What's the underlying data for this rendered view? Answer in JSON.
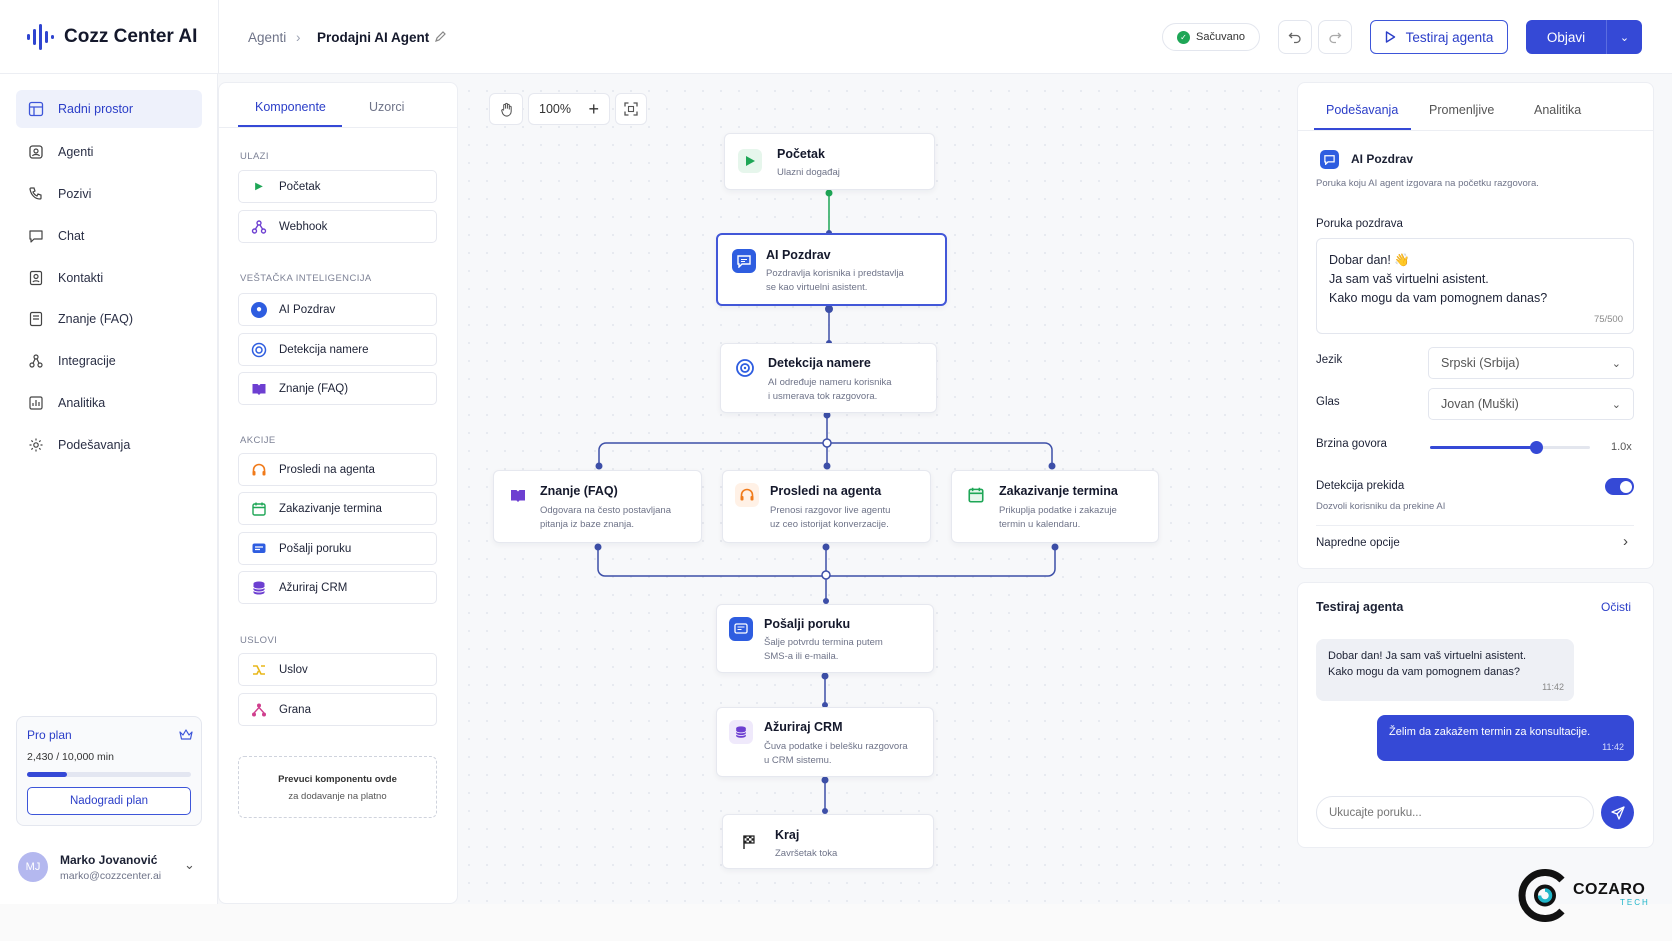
{
  "app": {
    "name": "Cozz Center AI"
  },
  "breadcrumb": {
    "parent": "Agenti",
    "current": "Prodajni AI Agent"
  },
  "header": {
    "saved_label": "Sačuvano",
    "test_button": "Testiraj agenta",
    "publish_button": "Objavi"
  },
  "sidebar": {
    "items": [
      {
        "label": "Radni prostor",
        "icon": "grid-icon"
      },
      {
        "label": "Agenti",
        "icon": "bot-icon"
      },
      {
        "label": "Pozivi",
        "icon": "phone-icon"
      },
      {
        "label": "Chat",
        "icon": "chat-icon"
      },
      {
        "label": "Kontakti",
        "icon": "contacts-icon"
      },
      {
        "label": "Znanje (FAQ)",
        "icon": "book-icon"
      },
      {
        "label": "Integracije",
        "icon": "integrations-icon"
      },
      {
        "label": "Analitika",
        "icon": "chart-icon"
      },
      {
        "label": "Podešavanja",
        "icon": "gear-icon"
      }
    ],
    "plan": {
      "name": "Pro plan",
      "usage": "2,430 / 10,000 min",
      "usage_fraction": 0.243,
      "upgrade_button": "Nadogradi plan"
    },
    "user": {
      "initials": "MJ",
      "name": "Marko Jovanović",
      "email": "marko@cozzcenter.ai"
    }
  },
  "components": {
    "tabs": [
      "Komponente",
      "Uzorci"
    ],
    "sections": [
      {
        "title": "ULAZI",
        "items": [
          "Početak",
          "Webhook"
        ]
      },
      {
        "title": "VEŠTAČKA INTELIGENCIJA",
        "items": [
          "AI Pozdrav",
          "Detekcija namere",
          "Znanje (FAQ)"
        ]
      },
      {
        "title": "AKCIJE",
        "items": [
          "Prosledi na agenta",
          "Zakazivanje termina",
          "Pošalji poruku",
          "Ažuriraj CRM"
        ]
      },
      {
        "title": "USLOVI",
        "items": [
          "Uslov",
          "Grana"
        ]
      }
    ],
    "drop_hint_line1": "Prevuci komponentu ovde",
    "drop_hint_line2": "za dodavanje na platno"
  },
  "canvas": {
    "zoom": "100%",
    "nodes": {
      "start": {
        "title": "Početak",
        "desc": "Ulazni događaj"
      },
      "greeting": {
        "title": "AI Pozdrav",
        "desc1": "Pozdravlja korisnika i predstavlja",
        "desc2": "se kao virtuelni asistent."
      },
      "intent": {
        "title": "Detekcija namere",
        "desc1": "AI određuje nameru korisnika",
        "desc2": "i usmerava tok razgovora."
      },
      "faq": {
        "title": "Znanje (FAQ)",
        "desc1": "Odgovara na često postavljana",
        "desc2": "pitanja iz baze znanja."
      },
      "handoff": {
        "title": "Prosledi na agenta",
        "desc1": "Prenosi razgovor live agentu",
        "desc2": "uz ceo istorijat konverzacije."
      },
      "schedule": {
        "title": "Zakazivanje termina",
        "desc1": "Prikuplja podatke i zakazuje",
        "desc2": "termin u kalendaru."
      },
      "message": {
        "title": "Pošalji poruku",
        "desc1": "Šalje potvrdu termina putem",
        "desc2": "SMS-a ili e-maila."
      },
      "crm": {
        "title": "Ažuriraj CRM",
        "desc1": "Čuva podatke i belešku razgovora",
        "desc2": "u CRM sistemu."
      },
      "end": {
        "title": "Kraj",
        "desc": "Završetak toka"
      }
    }
  },
  "settings": {
    "tabs": [
      "Podešavanja",
      "Promenljive",
      "Analitika"
    ],
    "node_title": "AI Pozdrav",
    "node_desc": "Poruka koju AI agent izgovara na početku razgovora.",
    "greeting_label": "Poruka pozdrava",
    "greeting_line1": "Dobar dan! 👋",
    "greeting_line2": "Ja sam vaš virtuelni asistent.",
    "greeting_line3": "Kako mogu da vam pomognem danas?",
    "char_count": "75/500",
    "language_label": "Jezik",
    "language_value": "Srpski (Srbija)",
    "voice_label": "Glas",
    "voice_value": "Jovan (Muški)",
    "speed_label": "Brzina govora",
    "speed_value": "1.0x",
    "speed_fraction": 0.66,
    "interrupt_label": "Detekcija prekida",
    "interrupt_desc": "Dozvoli korisniku da prekine AI",
    "interrupt_on": true,
    "advanced_label": "Napredne opcije"
  },
  "tester": {
    "title": "Testiraj agenta",
    "clear": "Očisti",
    "bot_line1": "Dobar dan! Ja sam vaš virtuelni asistent.",
    "bot_line2": "Kako mogu da vam pomognem danas?",
    "bot_time": "11:42",
    "user_msg": "Želim da zakažem termin za konsultacije.",
    "user_time": "11:42",
    "input_placeholder": "Ukucajte poruku..."
  },
  "brand": {
    "name": "COZARO",
    "sub": "TECH"
  },
  "colors": {
    "accent": "#3549d6",
    "success": "#1ea656",
    "faq": "#6d3fd1",
    "handoff": "#f07a1a",
    "schedule": "#1ea656"
  }
}
